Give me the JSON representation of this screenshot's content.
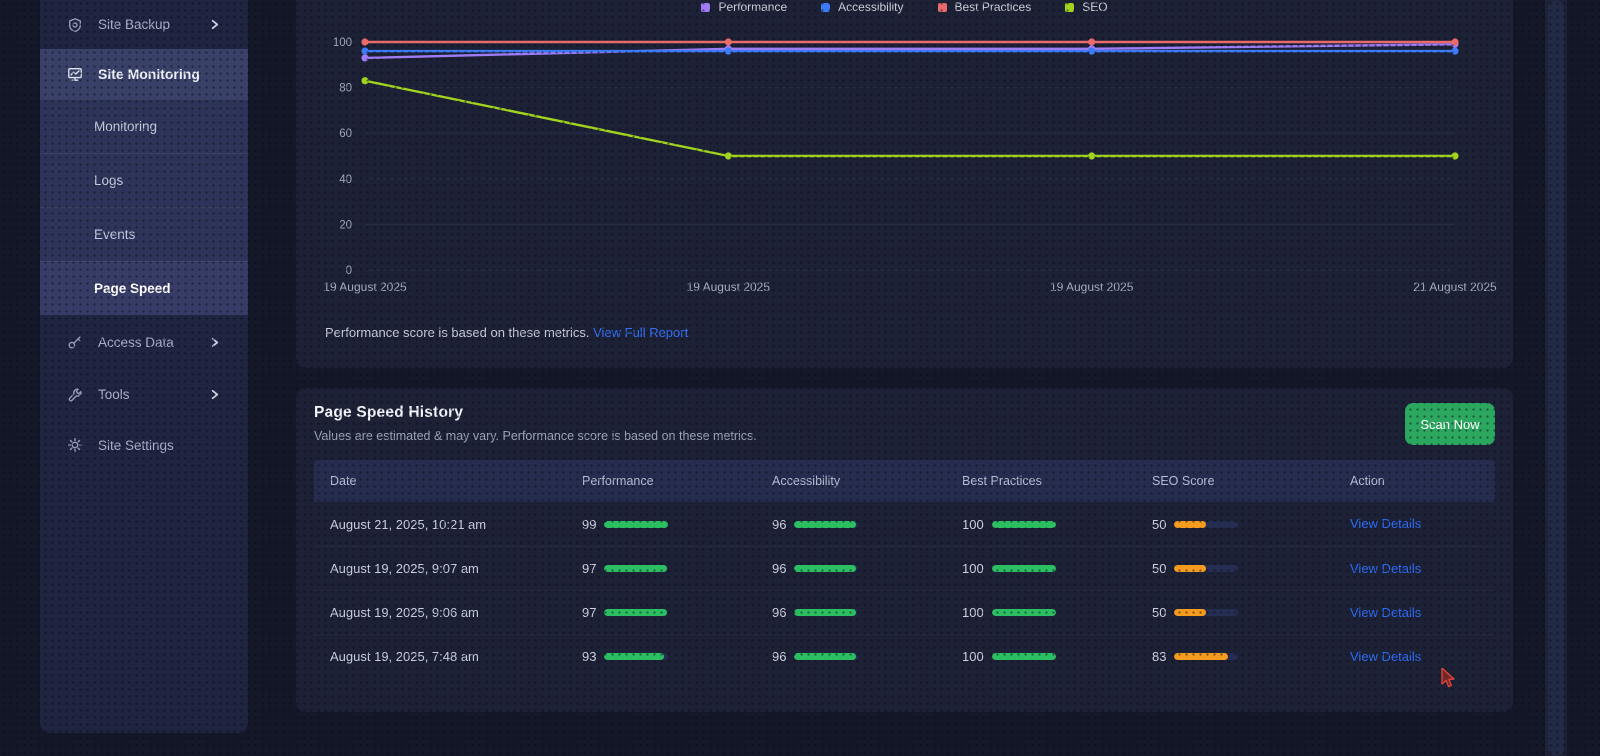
{
  "sidebar": {
    "items": [
      {
        "label": "Site Backup",
        "icon": "backup-icon",
        "chevron": true
      },
      {
        "label": "Site Monitoring",
        "icon": "monitor-icon",
        "active": true
      },
      {
        "label": "Monitoring",
        "sub": true
      },
      {
        "label": "Logs",
        "sub": true
      },
      {
        "label": "Events",
        "sub": true
      },
      {
        "label": "Page Speed",
        "sub": true,
        "active": true
      },
      {
        "label": "Access Data",
        "icon": "key-icon",
        "chevron": true
      },
      {
        "label": "Tools",
        "icon": "wrench-icon",
        "chevron": true
      },
      {
        "label": "Site Settings",
        "icon": "gear-icon"
      }
    ]
  },
  "chart_card": {
    "footer_text": "Performance score is based on these metrics.",
    "footer_link": "View Full Report"
  },
  "chart_data": {
    "type": "line",
    "x": [
      "19 August 2025",
      "19 August 2025",
      "19 August 2025",
      "21 August 2025"
    ],
    "series": [
      {
        "name": "Performance",
        "color": "#9f7cf5",
        "values": [
          93,
          97,
          97,
          99
        ]
      },
      {
        "name": "Accessibility",
        "color": "#3d7bf7",
        "values": [
          96,
          96,
          96,
          96
        ]
      },
      {
        "name": "Best Practices",
        "color": "#e86a6a",
        "values": [
          100,
          100,
          100,
          100
        ]
      },
      {
        "name": "SEO",
        "color": "#a2d41f",
        "values": [
          83,
          50,
          50,
          50
        ]
      }
    ],
    "ylim": [
      0,
      100
    ],
    "yticks": [
      0,
      20,
      40,
      60,
      80,
      100
    ],
    "grid": true,
    "legend_position": "top"
  },
  "history": {
    "title": "Page Speed History",
    "subtitle": "Values are estimated & may vary. Performance score is based on these metrics.",
    "scan_button": "Scan Now",
    "columns": [
      "Date",
      "Performance",
      "Accessibility",
      "Best Practices",
      "SEO Score",
      "Action"
    ],
    "rows": [
      {
        "date": "August 21, 2025, 10:21 am",
        "performance": 99,
        "accessibility": 96,
        "best_practices": 100,
        "seo": 50,
        "action": "View Details"
      },
      {
        "date": "August 19, 2025, 9:07 am",
        "performance": 97,
        "accessibility": 96,
        "best_practices": 100,
        "seo": 50,
        "action": "View Details"
      },
      {
        "date": "August 19, 2025, 9:06 am",
        "performance": 97,
        "accessibility": 96,
        "best_practices": 100,
        "seo": 50,
        "action": "View Details"
      },
      {
        "date": "August 19, 2025, 7:48 am",
        "performance": 93,
        "accessibility": 96,
        "best_practices": 100,
        "seo": 83,
        "action": "View Details"
      }
    ]
  },
  "colors": {
    "bar_green": "#2bbf62",
    "bar_orange": "#f59b1e",
    "bar_track": "#262d52",
    "link_blue": "#2e6bf3",
    "scan_button_green": "#2ca760",
    "card_bg": "#1c2136",
    "page_bg": "#131728",
    "sidebar_active_bg": "#3a4169"
  },
  "icons": {
    "backup": "backup-icon",
    "monitor": "monitor-icon",
    "key": "key-icon",
    "wrench": "wrench-icon",
    "gear": "gear-icon",
    "chevron": "›",
    "cursor": "pointer-arrow-icon"
  }
}
